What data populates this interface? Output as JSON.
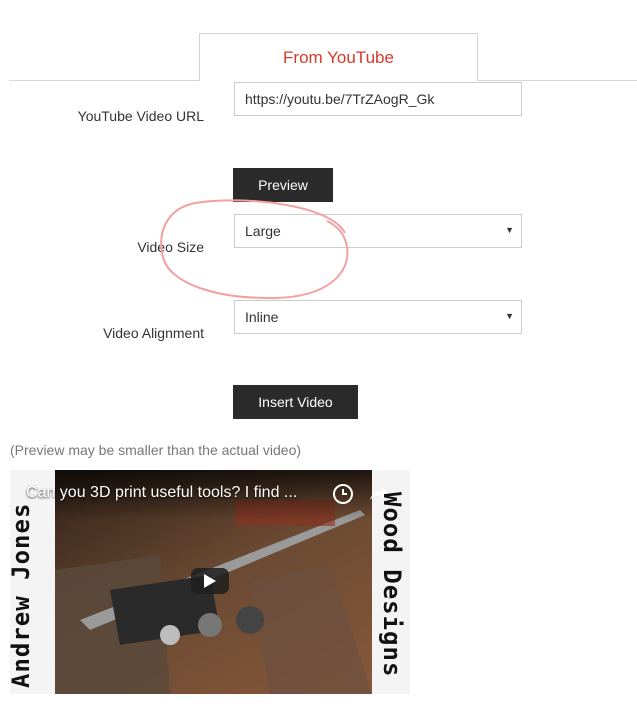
{
  "tab": {
    "label": "From YouTube"
  },
  "url_field": {
    "label": "YouTube Video URL",
    "value": "https://youtu.be/7TrZAogR_Gk"
  },
  "preview_button": {
    "label": "Preview"
  },
  "video_size": {
    "label": "Video Size",
    "selected": "Large"
  },
  "video_alignment": {
    "label": "Video Alignment",
    "selected": "Inline"
  },
  "insert_button": {
    "label": "Insert Video"
  },
  "preview_note": "(Preview may be smaller than the actual video)",
  "video": {
    "title": "Can you 3D print useful tools? I find ...",
    "left_text": "Andrew Jones",
    "right_text": "Wood Designs",
    "icons": [
      "clock-icon",
      "share-icon",
      "play-icon"
    ]
  },
  "colors": {
    "tab_text": "#d63a2b",
    "button_bg": "#2b2b2b",
    "annotation": "#f2a0a0"
  }
}
